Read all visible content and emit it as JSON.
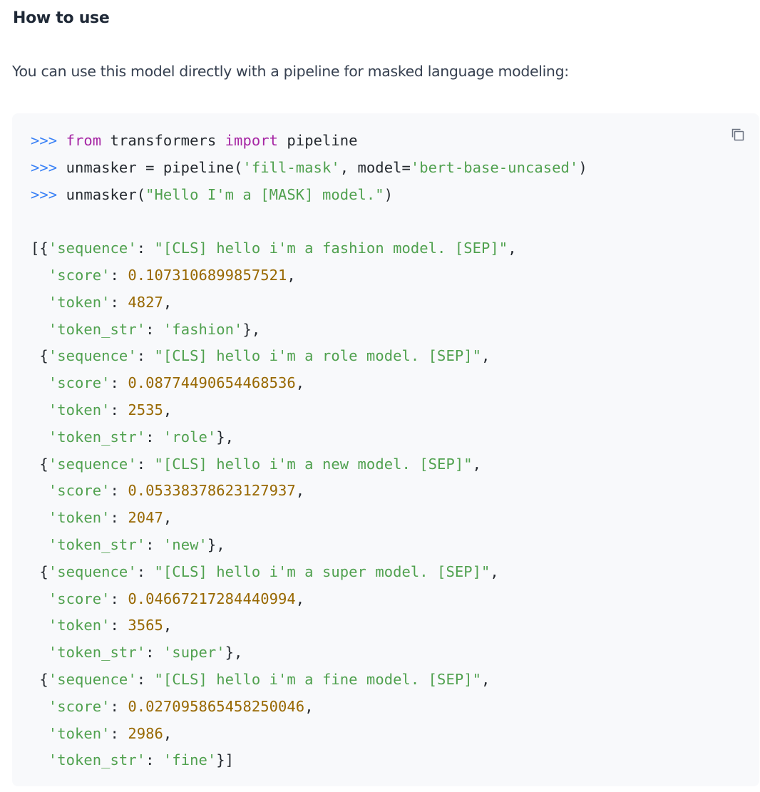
{
  "section": {
    "heading": "How to use",
    "intro": "You can use this model directly with a pipeline for masked language modeling:"
  },
  "icons": {
    "copy": "copy-icon"
  },
  "colors": {
    "prompt": "#3b82f6",
    "keyword": "#a626a4",
    "string": "#50a14f",
    "number": "#986801",
    "text": "#24292f",
    "code_background": "#f8f9fb"
  },
  "code": {
    "lines": [
      {
        "tokens": [
          {
            "t": "p",
            "v": ">>> "
          },
          {
            "t": "k",
            "v": "from"
          },
          {
            "t": "",
            "v": " transformers "
          },
          {
            "t": "k",
            "v": "import"
          },
          {
            "t": "",
            "v": " pipeline"
          }
        ]
      },
      {
        "tokens": [
          {
            "t": "p",
            "v": ">>> "
          },
          {
            "t": "",
            "v": "unmasker = pipeline("
          },
          {
            "t": "s",
            "v": "'fill-mask'"
          },
          {
            "t": "",
            "v": ", model="
          },
          {
            "t": "s",
            "v": "'bert-base-uncased'"
          },
          {
            "t": "",
            "v": ")"
          }
        ]
      },
      {
        "tokens": [
          {
            "t": "p",
            "v": ">>> "
          },
          {
            "t": "",
            "v": "unmasker("
          },
          {
            "t": "s",
            "v": "\"Hello I'm a [MASK] model.\""
          },
          {
            "t": "",
            "v": ")"
          }
        ]
      },
      {
        "tokens": []
      },
      {
        "tokens": [
          {
            "t": "",
            "v": "[{"
          },
          {
            "t": "s",
            "v": "'sequence'"
          },
          {
            "t": "",
            "v": ": "
          },
          {
            "t": "s",
            "v": "\"[CLS] hello i'm a fashion model. [SEP]\""
          },
          {
            "t": "",
            "v": ","
          }
        ]
      },
      {
        "tokens": [
          {
            "t": "",
            "v": "  "
          },
          {
            "t": "s",
            "v": "'score'"
          },
          {
            "t": "",
            "v": ": "
          },
          {
            "t": "n",
            "v": "0.1073106899857521"
          },
          {
            "t": "",
            "v": ","
          }
        ]
      },
      {
        "tokens": [
          {
            "t": "",
            "v": "  "
          },
          {
            "t": "s",
            "v": "'token'"
          },
          {
            "t": "",
            "v": ": "
          },
          {
            "t": "n",
            "v": "4827"
          },
          {
            "t": "",
            "v": ","
          }
        ]
      },
      {
        "tokens": [
          {
            "t": "",
            "v": "  "
          },
          {
            "t": "s",
            "v": "'token_str'"
          },
          {
            "t": "",
            "v": ": "
          },
          {
            "t": "s",
            "v": "'fashion'"
          },
          {
            "t": "",
            "v": "},"
          }
        ]
      },
      {
        "tokens": [
          {
            "t": "",
            "v": " {"
          },
          {
            "t": "s",
            "v": "'sequence'"
          },
          {
            "t": "",
            "v": ": "
          },
          {
            "t": "s",
            "v": "\"[CLS] hello i'm a role model. [SEP]\""
          },
          {
            "t": "",
            "v": ","
          }
        ]
      },
      {
        "tokens": [
          {
            "t": "",
            "v": "  "
          },
          {
            "t": "s",
            "v": "'score'"
          },
          {
            "t": "",
            "v": ": "
          },
          {
            "t": "n",
            "v": "0.08774490654468536"
          },
          {
            "t": "",
            "v": ","
          }
        ]
      },
      {
        "tokens": [
          {
            "t": "",
            "v": "  "
          },
          {
            "t": "s",
            "v": "'token'"
          },
          {
            "t": "",
            "v": ": "
          },
          {
            "t": "n",
            "v": "2535"
          },
          {
            "t": "",
            "v": ","
          }
        ]
      },
      {
        "tokens": [
          {
            "t": "",
            "v": "  "
          },
          {
            "t": "s",
            "v": "'token_str'"
          },
          {
            "t": "",
            "v": ": "
          },
          {
            "t": "s",
            "v": "'role'"
          },
          {
            "t": "",
            "v": "},"
          }
        ]
      },
      {
        "tokens": [
          {
            "t": "",
            "v": " {"
          },
          {
            "t": "s",
            "v": "'sequence'"
          },
          {
            "t": "",
            "v": ": "
          },
          {
            "t": "s",
            "v": "\"[CLS] hello i'm a new model. [SEP]\""
          },
          {
            "t": "",
            "v": ","
          }
        ]
      },
      {
        "tokens": [
          {
            "t": "",
            "v": "  "
          },
          {
            "t": "s",
            "v": "'score'"
          },
          {
            "t": "",
            "v": ": "
          },
          {
            "t": "n",
            "v": "0.05338378623127937"
          },
          {
            "t": "",
            "v": ","
          }
        ]
      },
      {
        "tokens": [
          {
            "t": "",
            "v": "  "
          },
          {
            "t": "s",
            "v": "'token'"
          },
          {
            "t": "",
            "v": ": "
          },
          {
            "t": "n",
            "v": "2047"
          },
          {
            "t": "",
            "v": ","
          }
        ]
      },
      {
        "tokens": [
          {
            "t": "",
            "v": "  "
          },
          {
            "t": "s",
            "v": "'token_str'"
          },
          {
            "t": "",
            "v": ": "
          },
          {
            "t": "s",
            "v": "'new'"
          },
          {
            "t": "",
            "v": "},"
          }
        ]
      },
      {
        "tokens": [
          {
            "t": "",
            "v": " {"
          },
          {
            "t": "s",
            "v": "'sequence'"
          },
          {
            "t": "",
            "v": ": "
          },
          {
            "t": "s",
            "v": "\"[CLS] hello i'm a super model. [SEP]\""
          },
          {
            "t": "",
            "v": ","
          }
        ]
      },
      {
        "tokens": [
          {
            "t": "",
            "v": "  "
          },
          {
            "t": "s",
            "v": "'score'"
          },
          {
            "t": "",
            "v": ": "
          },
          {
            "t": "n",
            "v": "0.04667217284440994"
          },
          {
            "t": "",
            "v": ","
          }
        ]
      },
      {
        "tokens": [
          {
            "t": "",
            "v": "  "
          },
          {
            "t": "s",
            "v": "'token'"
          },
          {
            "t": "",
            "v": ": "
          },
          {
            "t": "n",
            "v": "3565"
          },
          {
            "t": "",
            "v": ","
          }
        ]
      },
      {
        "tokens": [
          {
            "t": "",
            "v": "  "
          },
          {
            "t": "s",
            "v": "'token_str'"
          },
          {
            "t": "",
            "v": ": "
          },
          {
            "t": "s",
            "v": "'super'"
          },
          {
            "t": "",
            "v": "},"
          }
        ]
      },
      {
        "tokens": [
          {
            "t": "",
            "v": " {"
          },
          {
            "t": "s",
            "v": "'sequence'"
          },
          {
            "t": "",
            "v": ": "
          },
          {
            "t": "s",
            "v": "\"[CLS] hello i'm a fine model. [SEP]\""
          },
          {
            "t": "",
            "v": ","
          }
        ]
      },
      {
        "tokens": [
          {
            "t": "",
            "v": "  "
          },
          {
            "t": "s",
            "v": "'score'"
          },
          {
            "t": "",
            "v": ": "
          },
          {
            "t": "n",
            "v": "0.027095865458250046"
          },
          {
            "t": "",
            "v": ","
          }
        ]
      },
      {
        "tokens": [
          {
            "t": "",
            "v": "  "
          },
          {
            "t": "s",
            "v": "'token'"
          },
          {
            "t": "",
            "v": ": "
          },
          {
            "t": "n",
            "v": "2986"
          },
          {
            "t": "",
            "v": ","
          }
        ]
      },
      {
        "tokens": [
          {
            "t": "",
            "v": "  "
          },
          {
            "t": "s",
            "v": "'token_str'"
          },
          {
            "t": "",
            "v": ": "
          },
          {
            "t": "s",
            "v": "'fine'"
          },
          {
            "t": "",
            "v": "}]"
          }
        ]
      }
    ]
  }
}
